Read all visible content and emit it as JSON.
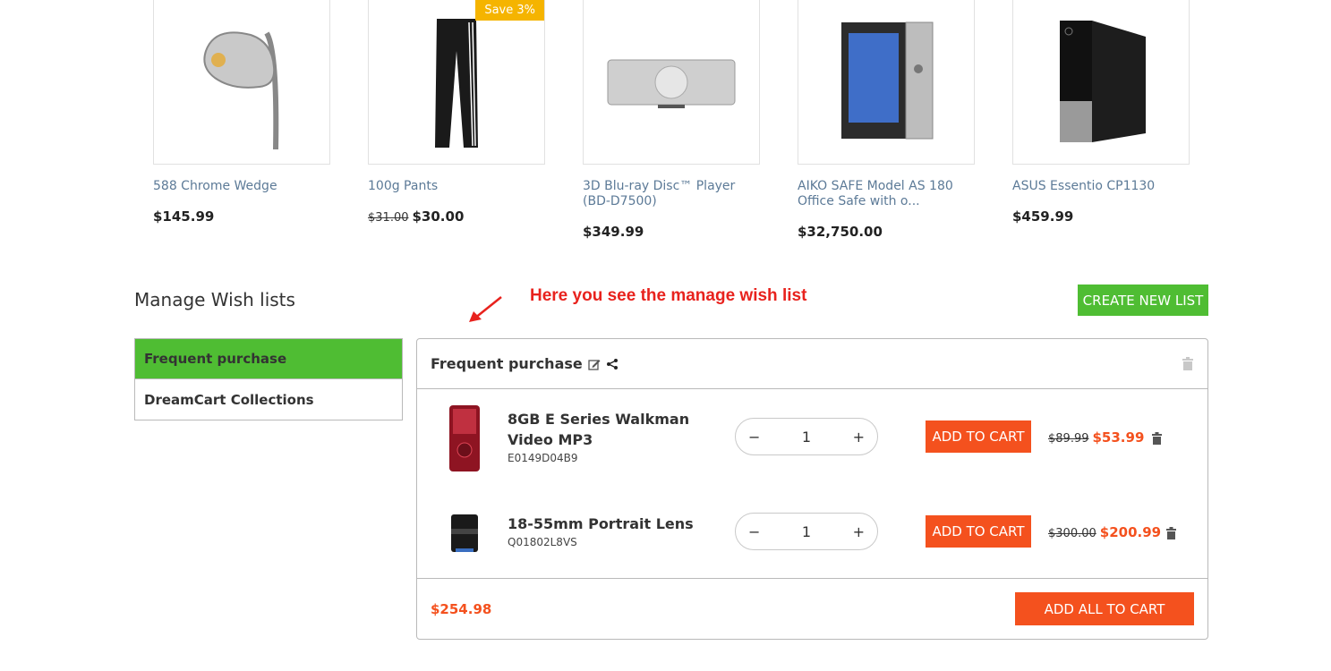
{
  "products": [
    {
      "name": "588 Chrome Wedge",
      "price": "$145.99",
      "old_price": null,
      "badge": null,
      "icon": "golf-wedge-image"
    },
    {
      "name": "100g Pants",
      "price": "$30.00",
      "old_price": "$31.00",
      "badge": "Save 3%",
      "icon": "track-pants-image"
    },
    {
      "name": "3D Blu-ray Disc™ Player (BD-D7500)",
      "price": "$349.99",
      "old_price": null,
      "badge": null,
      "icon": "bluray-player-image"
    },
    {
      "name": "AIKO SAFE Model AS 180 Office Safe with o...",
      "price": "$32,750.00",
      "old_price": null,
      "badge": null,
      "icon": "office-safe-image"
    },
    {
      "name": "ASUS Essentio CP1130",
      "price": "$459.99",
      "old_price": null,
      "badge": null,
      "icon": "desktop-tower-image"
    }
  ],
  "manage": {
    "title": "Manage Wish lists",
    "annotation": "Here you see the manage wish list",
    "create_label": "CREATE NEW LIST"
  },
  "lists": [
    {
      "label": "Frequent purchase",
      "active": true
    },
    {
      "label": "DreamCart Collections",
      "active": false
    }
  ],
  "panel": {
    "title": "Frequent purchase",
    "items": [
      {
        "name": "8GB E Series Walkman Video MP3",
        "sku": "E0149D04B9",
        "qty": "1",
        "old_price": "$89.99",
        "price": "$53.99",
        "add_label": "ADD TO CART",
        "icon": "walkman-image"
      },
      {
        "name": "18-55mm Portrait Lens",
        "sku": "Q01802L8VS",
        "qty": "1",
        "old_price": "$300.00",
        "price": "$200.99",
        "add_label": "ADD TO CART",
        "icon": "camera-lens-image"
      }
    ],
    "total": "$254.98",
    "add_all_label": "ADD ALL TO CART"
  },
  "colors": {
    "accent_green": "#4fbd33",
    "accent_orange": "#f4511e",
    "badge_yellow": "#f5b400",
    "annotation_red": "#e8221d",
    "link_blue": "#5c7a97"
  }
}
